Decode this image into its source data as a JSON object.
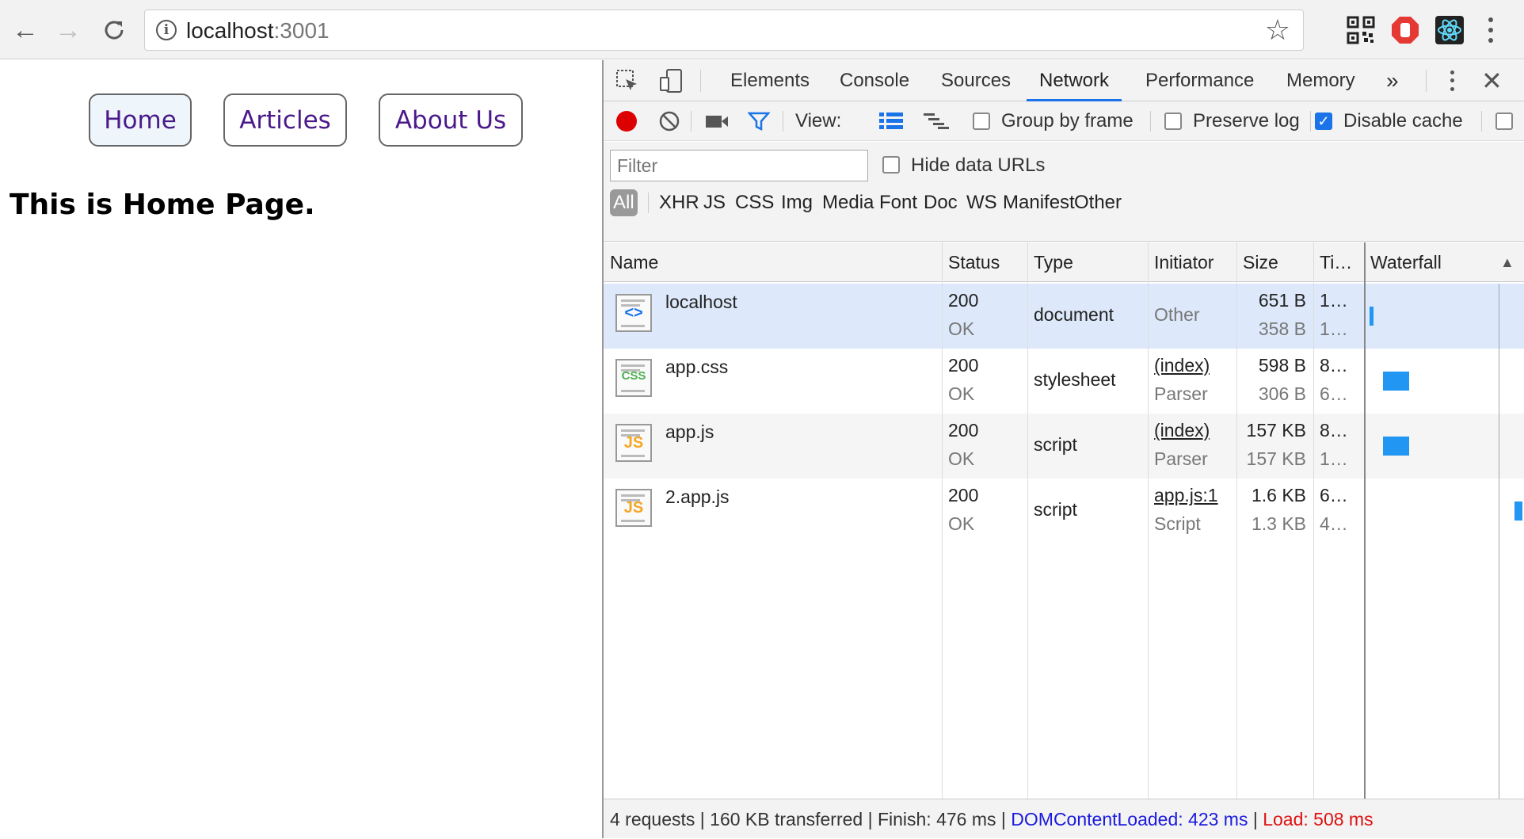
{
  "browser": {
    "url_host": "localhost",
    "url_port": ":3001"
  },
  "page": {
    "nav": [
      {
        "label": "Home"
      },
      {
        "label": "Articles"
      },
      {
        "label": "About Us"
      }
    ],
    "heading": "This is Home Page."
  },
  "devtools": {
    "tabs": [
      "Elements",
      "Console",
      "Sources",
      "Network",
      "Performance",
      "Memory"
    ],
    "active_tab": "Network",
    "more_tabs": "»",
    "toolbar": {
      "view_label": "View:",
      "group_by_frame": "Group by frame",
      "preserve_log": "Preserve log",
      "disable_cache": "Disable cache"
    },
    "filter_placeholder": "Filter",
    "hide_data_urls": "Hide data URLs",
    "type_filters": [
      "All",
      "XHR",
      "JS",
      "CSS",
      "Img",
      "Media",
      "Font",
      "Doc",
      "WS",
      "Manifest",
      "Other"
    ],
    "columns": [
      "Name",
      "Status",
      "Type",
      "Initiator",
      "Size",
      "Ti…",
      "Waterfall"
    ],
    "sort_indicator": "▲",
    "requests": [
      {
        "name": "localhost",
        "icon": "html-file-icon",
        "icon_label": "<>",
        "status": "200",
        "status_text": "OK",
        "type": "document",
        "initiator": "Other",
        "initiator_sub": "",
        "size": "651 B",
        "size_sub": "358 B",
        "time": "1…",
        "time_sub": "1…",
        "wf_start": 0.015,
        "wf_len": 0.007
      },
      {
        "name": "app.css",
        "icon": "css-file-icon",
        "icon_label": "CSS",
        "status": "200",
        "status_text": "OK",
        "type": "stylesheet",
        "initiator": "(index)",
        "initiator_sub": "Parser",
        "size": "598 B",
        "size_sub": "306 B",
        "time": "8…",
        "time_sub": "6…",
        "wf_start": 0.1,
        "wf_len": 0.17
      },
      {
        "name": "app.js",
        "icon": "js-file-icon",
        "icon_label": "JS",
        "status": "200",
        "status_text": "OK",
        "type": "script",
        "initiator": "(index)",
        "initiator_sub": "Parser",
        "size": "157 KB",
        "size_sub": "157 KB",
        "time": "8…",
        "time_sub": "1…",
        "wf_start": 0.1,
        "wf_len": 0.17
      },
      {
        "name": "2.app.js",
        "icon": "js-file-icon",
        "icon_label": "JS",
        "status": "200",
        "status_text": "OK",
        "type": "script",
        "initiator": "app.js:1",
        "initiator_sub": "Script",
        "size": "1.6 KB",
        "size_sub": "1.3 KB",
        "time": "6…",
        "time_sub": "4…",
        "wf_start": 0.95,
        "wf_len": 0.05
      }
    ],
    "status_bar": {
      "summary": "4 requests | 160 KB transferred | Finish: 476 ms | ",
      "dcl": "DOMContentLoaded: 423 ms",
      "sep": " | ",
      "load": "Load: 508 ms"
    }
  }
}
